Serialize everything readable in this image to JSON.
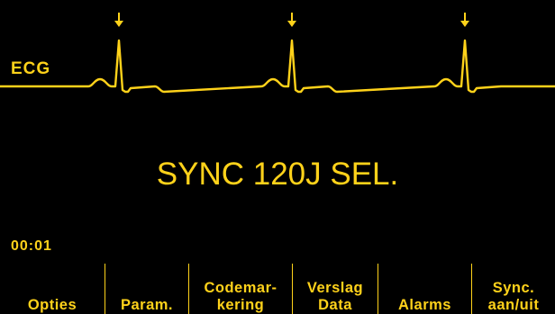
{
  "monitor": {
    "trace_label": "ECG",
    "message": "SYNC 120J SEL.",
    "elapsed_time": "00:01",
    "colors": {
      "foreground": "#ffd21a",
      "background": "#000000"
    },
    "sync_marker_icon": "down-arrow-icon"
  },
  "softkeys": [
    {
      "line1": "",
      "line2": "Opties"
    },
    {
      "line1": "",
      "line2": "Param."
    },
    {
      "line1": "Codemar-",
      "line2": "kering"
    },
    {
      "line1": "Verslag",
      "line2": "Data"
    },
    {
      "line1": "",
      "line2": "Alarms"
    },
    {
      "line1": "Sync.",
      "line2": "aan/uit"
    }
  ]
}
